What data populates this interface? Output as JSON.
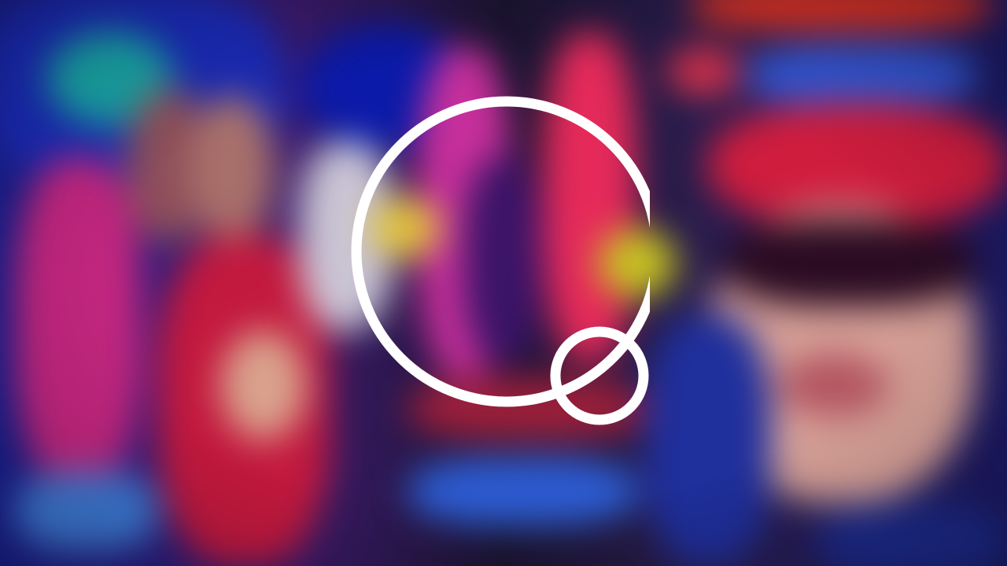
{
  "thumbnail": {
    "state": "blurred-loading",
    "accent": "#ffffff",
    "palette": [
      "#1a2bb8",
      "#c2267e",
      "#c3193e",
      "#19b4a6",
      "#e52a5a",
      "#3357d6",
      "#cf1d3e",
      "#d6a097"
    ]
  },
  "overlay_icon": {
    "icon": "magnifier-logo-icon",
    "stroke_color": "#ffffff"
  }
}
